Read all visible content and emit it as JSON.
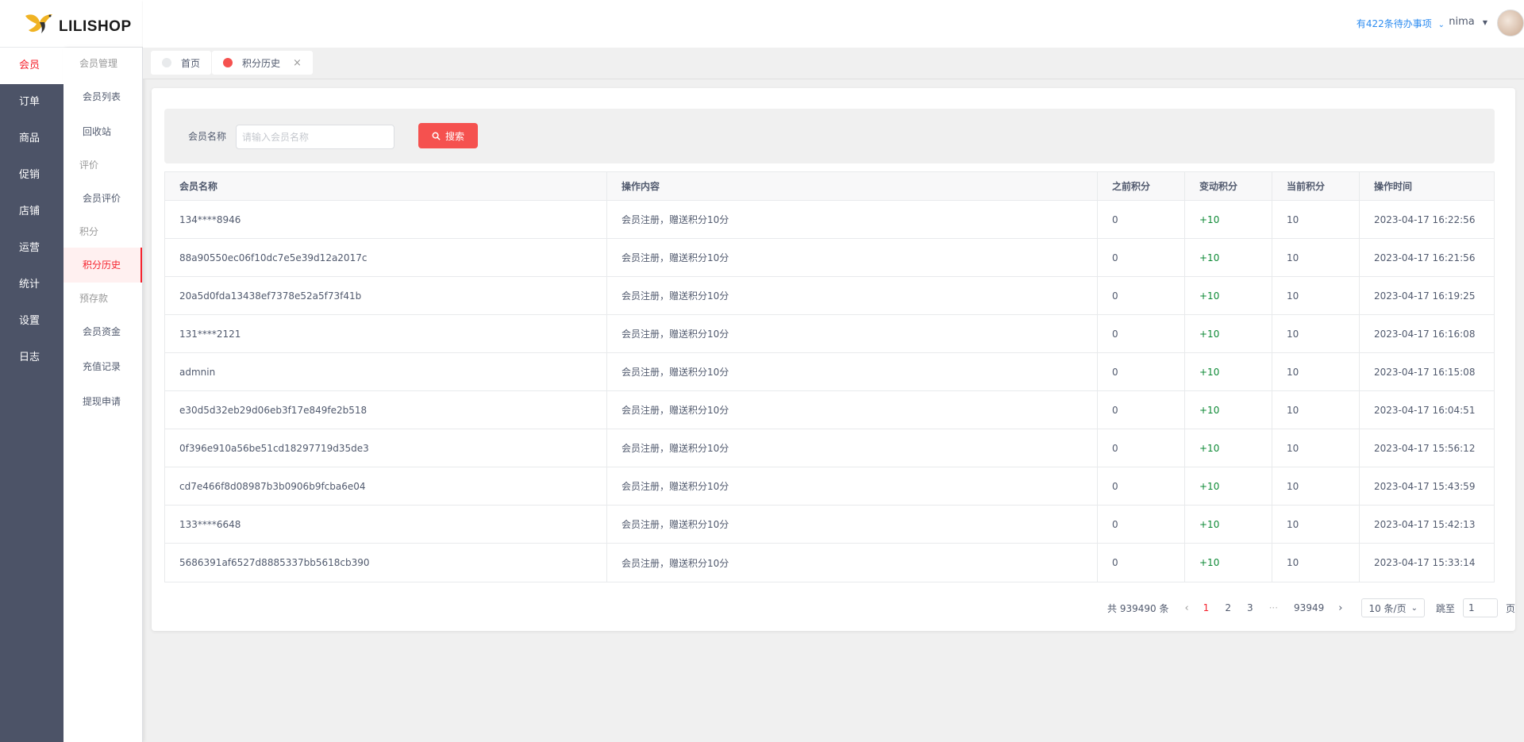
{
  "app": {
    "brand": "LILISHOP"
  },
  "nav": {
    "items": [
      "会员",
      "订单",
      "商品",
      "促销",
      "店铺",
      "运营",
      "统计",
      "设置",
      "日志"
    ]
  },
  "submenu": {
    "groups": [
      {
        "title": "会员管理",
        "items": [
          "会员列表",
          "回收站"
        ]
      },
      {
        "title": "评价",
        "items": [
          "会员评价"
        ]
      },
      {
        "title": "积分",
        "items": [
          "积分历史"
        ]
      },
      {
        "title": "预存款",
        "items": [
          "会员资金",
          "充值记录",
          "提现申请"
        ]
      }
    ]
  },
  "header": {
    "todo": "有422条待办事项",
    "username": "nima"
  },
  "tabs": [
    {
      "label": "首页",
      "dot_color": "#e8eaec"
    },
    {
      "label": "积分历史",
      "dot_color": "#f5514f",
      "close": "×"
    }
  ],
  "search": {
    "label": "会员名称",
    "placeholder": "请输入会员名称",
    "button": "搜索"
  },
  "table": {
    "columns": [
      "会员名称",
      "操作内容",
      "之前积分",
      "变动积分",
      "当前积分",
      "操作时间"
    ],
    "rows": [
      [
        "134****8946",
        "会员注册，赠送积分10分",
        "0",
        "+10",
        "10",
        "2023-04-17 16:22:56"
      ],
      [
        "88a90550ec06f10dc7e5e39d12a2017c",
        "会员注册，赠送积分10分",
        "0",
        "+10",
        "10",
        "2023-04-17 16:21:56"
      ],
      [
        "20a5d0fda13438ef7378e52a5f73f41b",
        "会员注册，赠送积分10分",
        "0",
        "+10",
        "10",
        "2023-04-17 16:19:25"
      ],
      [
        "131****2121",
        "会员注册，赠送积分10分",
        "0",
        "+10",
        "10",
        "2023-04-17 16:16:08"
      ],
      [
        "admnin",
        "会员注册，赠送积分10分",
        "0",
        "+10",
        "10",
        "2023-04-17 16:15:08"
      ],
      [
        "e30d5d32eb29d06eb3f17e849fe2b518",
        "会员注册，赠送积分10分",
        "0",
        "+10",
        "10",
        "2023-04-17 16:04:51"
      ],
      [
        "0f396e910a56be51cd18297719d35de3",
        "会员注册，赠送积分10分",
        "0",
        "+10",
        "10",
        "2023-04-17 15:56:12"
      ],
      [
        "cd7e466f8d08987b3b0906b9fcba6e04",
        "会员注册，赠送积分10分",
        "0",
        "+10",
        "10",
        "2023-04-17 15:43:59"
      ],
      [
        "133****6648",
        "会员注册，赠送积分10分",
        "0",
        "+10",
        "10",
        "2023-04-17 15:42:13"
      ],
      [
        "5686391af6527d8885337bb5618cb390",
        "会员注册，赠送积分10分",
        "0",
        "+10",
        "10",
        "2023-04-17 15:33:14"
      ]
    ]
  },
  "pagination": {
    "total": "共 939490 条",
    "pages": [
      "1",
      "2",
      "3"
    ],
    "ellipsis": "···",
    "last_page": "93949",
    "current": "1",
    "page_size": "10 条/页",
    "jump_label": "跳至",
    "jump_value": "1",
    "page_suffix": "页"
  },
  "colors": {
    "accent": "#f5222d",
    "nav_bg": "#4c5367",
    "button_bg": "#f5514f",
    "positive": "#0e8a36",
    "link": "#2d8cf0"
  }
}
